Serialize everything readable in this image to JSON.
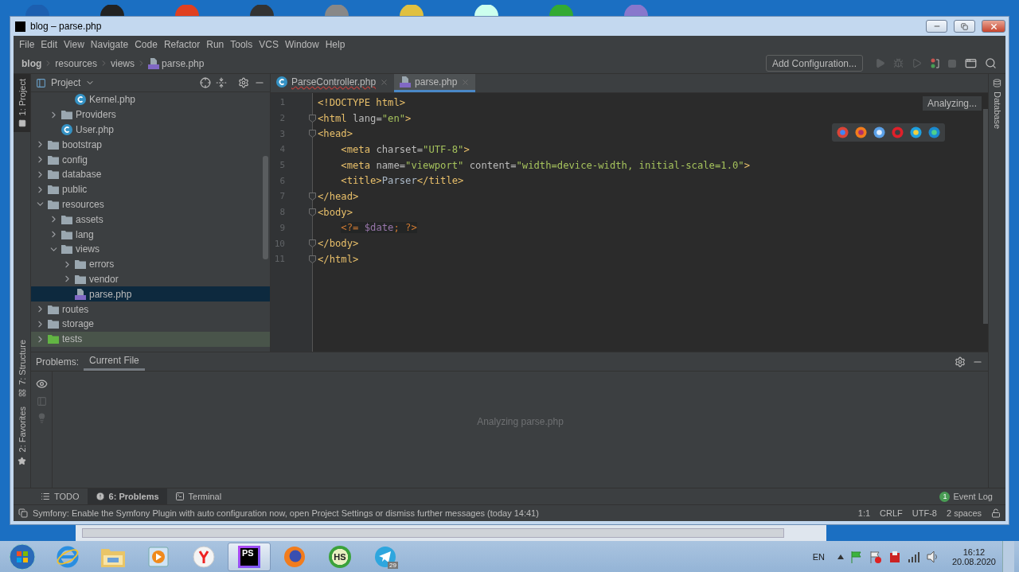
{
  "window": {
    "title": "blog – parse.php"
  },
  "menu": [
    "File",
    "Edit",
    "View",
    "Navigate",
    "Code",
    "Refactor",
    "Run",
    "Tools",
    "VCS",
    "Window",
    "Help"
  ],
  "breadcrumbs": [
    {
      "label": "blog",
      "kind": "project"
    },
    {
      "label": "resources",
      "kind": "folder"
    },
    {
      "label": "views",
      "kind": "folder"
    },
    {
      "label": "parse.php",
      "kind": "php"
    }
  ],
  "run_config": {
    "label": "Add Configuration..."
  },
  "left_stripe": [
    {
      "label": "1: Project",
      "kind": "project",
      "selected": true
    },
    {
      "label": "7: Structure",
      "kind": "structure",
      "selected": false
    },
    {
      "label": "2: Favorites",
      "kind": "favorites",
      "selected": false
    }
  ],
  "right_stripe": [
    {
      "label": "Database",
      "selected": false
    }
  ],
  "project_panel": {
    "title": "Project",
    "tree": [
      {
        "children": [
          {
            "children": [
              {
                "label": "Kernel.php",
                "kind": "class",
                "selected": false
              }
            ]
          },
          {
            "label": "Providers",
            "kind": "folder",
            "expanded": false,
            "selected": false
          },
          {
            "label": "User.php",
            "kind": "class",
            "selected": false
          }
        ]
      },
      {
        "label": "bootstrap",
        "kind": "folder",
        "expanded": false,
        "selected": false
      },
      {
        "label": "config",
        "kind": "folder",
        "expanded": false,
        "selected": false
      },
      {
        "label": "database",
        "kind": "folder",
        "expanded": false,
        "selected": false
      },
      {
        "label": "public",
        "kind": "folder",
        "expanded": false,
        "selected": false
      },
      {
        "label": "resources",
        "kind": "folder",
        "expanded": true,
        "selected": false,
        "children": [
          {
            "label": "assets",
            "kind": "folder",
            "expanded": false,
            "selected": false
          },
          {
            "label": "lang",
            "kind": "folder",
            "expanded": false,
            "selected": false
          },
          {
            "label": "views",
            "kind": "folder",
            "expanded": true,
            "selected": false,
            "children": [
              {
                "label": "errors",
                "kind": "folder",
                "expanded": false,
                "selected": false
              },
              {
                "label": "vendor",
                "kind": "folder",
                "expanded": false,
                "selected": false
              },
              {
                "label": "parse.php",
                "kind": "php",
                "selected": true
              }
            ]
          }
        ]
      },
      {
        "label": "routes",
        "kind": "folder",
        "expanded": false,
        "selected": false
      },
      {
        "label": "storage",
        "kind": "folder",
        "expanded": false,
        "selected": false
      },
      {
        "label": "tests",
        "kind": "test_folder",
        "expanded": false,
        "selected": false
      }
    ]
  },
  "editor": {
    "tabs": [
      {
        "label": "ParseController.php",
        "kind": "class",
        "has_error": true,
        "selected": false
      },
      {
        "label": "parse.php",
        "kind": "php",
        "has_error": false,
        "selected": true
      }
    ],
    "status": "Analyzing...",
    "lines": [
      {
        "number": "1",
        "fold": false,
        "indented": false,
        "tokens": [
          {
            "kind": "tag",
            "text": "<!DOCTYPE html>"
          }
        ]
      },
      {
        "number": "2",
        "fold": true,
        "indented": false,
        "tokens": [
          {
            "kind": "tag",
            "text": "<html "
          },
          {
            "kind": "attr",
            "text": "lang="
          },
          {
            "kind": "value",
            "text": "\"en\""
          },
          {
            "kind": "tag",
            "text": ">"
          }
        ]
      },
      {
        "number": "3",
        "fold": true,
        "indented": false,
        "tokens": [
          {
            "kind": "tag",
            "text": "<head>"
          }
        ]
      },
      {
        "number": "4",
        "fold": false,
        "indented": true,
        "tokens": [
          {
            "kind": "tag",
            "text": "<meta "
          },
          {
            "kind": "attr",
            "text": "charset="
          },
          {
            "kind": "value",
            "text": "\"UTF-8\""
          },
          {
            "kind": "tag",
            "text": ">"
          }
        ]
      },
      {
        "number": "5",
        "fold": false,
        "indented": true,
        "tokens": [
          {
            "kind": "tag",
            "text": "<meta "
          },
          {
            "kind": "attr",
            "text": "name="
          },
          {
            "kind": "value",
            "text": "\"viewport\""
          },
          {
            "kind": "attr",
            "text": " content="
          },
          {
            "kind": "value",
            "text": "\"width=device-width, initial-scale=1.0\""
          },
          {
            "kind": "tag",
            "text": ">"
          }
        ]
      },
      {
        "number": "6",
        "fold": false,
        "indented": true,
        "tokens": [
          {
            "kind": "tag",
            "text": "<title>"
          },
          {
            "kind": "text",
            "text": "Parser"
          },
          {
            "kind": "tag",
            "text": "</title>"
          }
        ]
      },
      {
        "number": "7",
        "fold": true,
        "indented": false,
        "tokens": [
          {
            "kind": "tag",
            "text": "</head>"
          }
        ]
      },
      {
        "number": "8",
        "fold": true,
        "indented": false,
        "tokens": [
          {
            "kind": "tag",
            "text": "<body>"
          }
        ]
      },
      {
        "number": "9",
        "fold": false,
        "indented": true,
        "tokens": [
          {
            "kind": "php",
            "text": "<?= "
          },
          {
            "kind": "php_var",
            "text": "$date"
          },
          {
            "kind": "php",
            "text": "; ?>"
          }
        ]
      },
      {
        "number": "10",
        "fold": true,
        "indented": false,
        "tokens": [
          {
            "kind": "tag",
            "text": "</body>"
          }
        ]
      },
      {
        "number": "11",
        "fold": true,
        "indented": false,
        "tokens": [
          {
            "kind": "tag",
            "text": "</html>"
          }
        ]
      }
    ]
  },
  "problems": {
    "label": "Problems:",
    "tabs": [
      {
        "label": "Current File",
        "selected": true
      }
    ],
    "message": "Analyzing parse.php"
  },
  "tool_windows": [
    {
      "label": "TODO",
      "kind": "todo",
      "selected": false
    },
    {
      "label": "6: Problems",
      "kind": "problems",
      "selected": true
    },
    {
      "label": "Terminal",
      "kind": "terminal",
      "selected": false
    }
  ],
  "event_log": {
    "label": "Event Log",
    "count": "1"
  },
  "status_bar": {
    "message": "Symfony: Enable the Symfony Plugin with auto configuration now, open Project Settings or dismiss further messages (today 14:41)",
    "items": [
      "1:1",
      "CRLF",
      "UTF-8",
      "2 spaces"
    ]
  },
  "taskbar": {
    "apps": [
      {
        "kind": "ie",
        "selected": false
      },
      {
        "kind": "explorer",
        "selected": false
      },
      {
        "kind": "media",
        "selected": false
      },
      {
        "kind": "yandex",
        "selected": false
      },
      {
        "kind": "phpstorm",
        "logo": "PS",
        "selected": true
      },
      {
        "kind": "firefox",
        "selected": false
      },
      {
        "kind": "hs",
        "logo": "HS",
        "selected": false
      },
      {
        "kind": "telegram",
        "badge": "29",
        "selected": false
      }
    ],
    "language": "EN",
    "time": "16:12",
    "date": "20.08.2020"
  }
}
